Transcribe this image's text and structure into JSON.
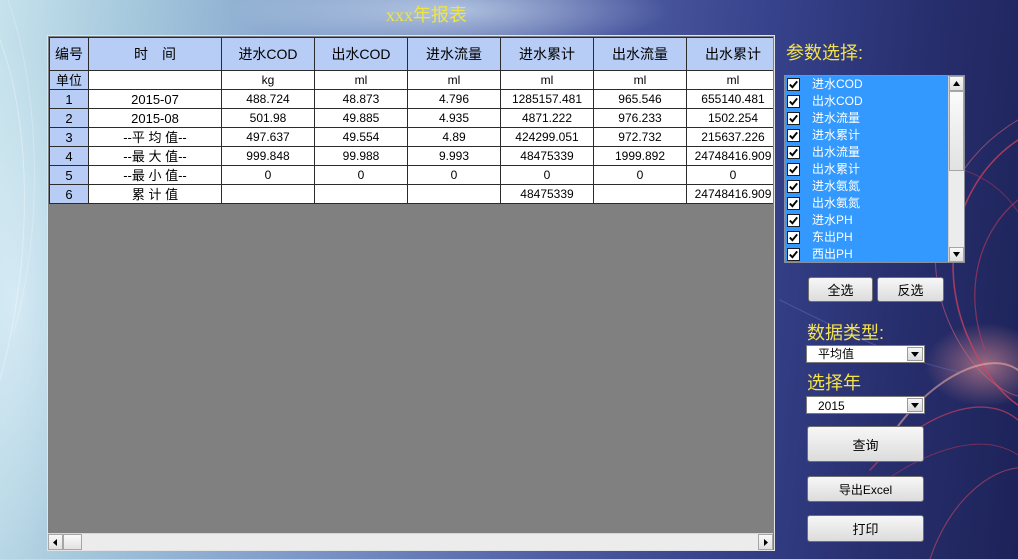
{
  "window": {
    "title": "xxx年报表"
  },
  "table": {
    "columns": [
      "编号",
      "时　间",
      "进水COD",
      "出水COD",
      "进水流量",
      "进水累计",
      "出水流量",
      "出水累计"
    ],
    "units": [
      "单位",
      "",
      "kg",
      "ml",
      "ml",
      "ml",
      "ml",
      "ml"
    ],
    "rows": [
      [
        "1",
        "2015-07",
        "488.724",
        "48.873",
        "4.796",
        "1285157.481",
        "965.546",
        "655140.481"
      ],
      [
        "2",
        "2015-08",
        "501.98",
        "49.885",
        "4.935",
        "4871.222",
        "976.233",
        "1502.254"
      ],
      [
        "3",
        "--平 均 值--",
        "497.637",
        "49.554",
        "4.89",
        "424299.051",
        "972.732",
        "215637.226"
      ],
      [
        "4",
        "--最 大 值--",
        "999.848",
        "99.988",
        "9.993",
        "48475339",
        "1999.892",
        "24748416.909"
      ],
      [
        "5",
        "--最 小 值--",
        "0",
        "0",
        "0",
        "0",
        "0",
        "0"
      ],
      [
        "6",
        "累 计 值",
        "",
        "",
        "",
        "48475339",
        "",
        "24748416.909"
      ]
    ]
  },
  "params": {
    "label": "参数选择:",
    "items": [
      {
        "label": "进水COD",
        "checked": true
      },
      {
        "label": "出水COD",
        "checked": true
      },
      {
        "label": "进水流量",
        "checked": true
      },
      {
        "label": "进水累计",
        "checked": true
      },
      {
        "label": "出水流量",
        "checked": true
      },
      {
        "label": "出水累计",
        "checked": true
      },
      {
        "label": "进水氨氮",
        "checked": true
      },
      {
        "label": "出水氨氮",
        "checked": true
      },
      {
        "label": "进水PH",
        "checked": true
      },
      {
        "label": "东出PH",
        "checked": true
      },
      {
        "label": "西出PH",
        "checked": true
      }
    ]
  },
  "selection": {
    "select_all": "全选",
    "invert": "反选"
  },
  "data_type": {
    "label": "数据类型:",
    "value": "平均值"
  },
  "year": {
    "label": "选择年",
    "value": "2015"
  },
  "actions": {
    "query": "查询",
    "export": "导出Excel",
    "print": "打印"
  },
  "scroll": {
    "horizontal": 0,
    "params_list": 0
  },
  "icons": {
    "checkbox": "check-mark-icon",
    "scroll_left": "arrow-left-icon",
    "scroll_right": "arrow-right-icon",
    "scroll_up": "arrow-up-icon",
    "scroll_down": "arrow-down-icon",
    "dropdown": "chevron-down-icon"
  },
  "colors": {
    "title_yellow": "#f1e43c",
    "label_yellow": "#f4e24a",
    "header_blue": "#b7cdf5",
    "selection_blue": "#3399ff",
    "grid_gray": "#808080",
    "background_dark": "#1d2358",
    "background_light": "#c6e2ec",
    "swirl_red": "#d0405c"
  }
}
